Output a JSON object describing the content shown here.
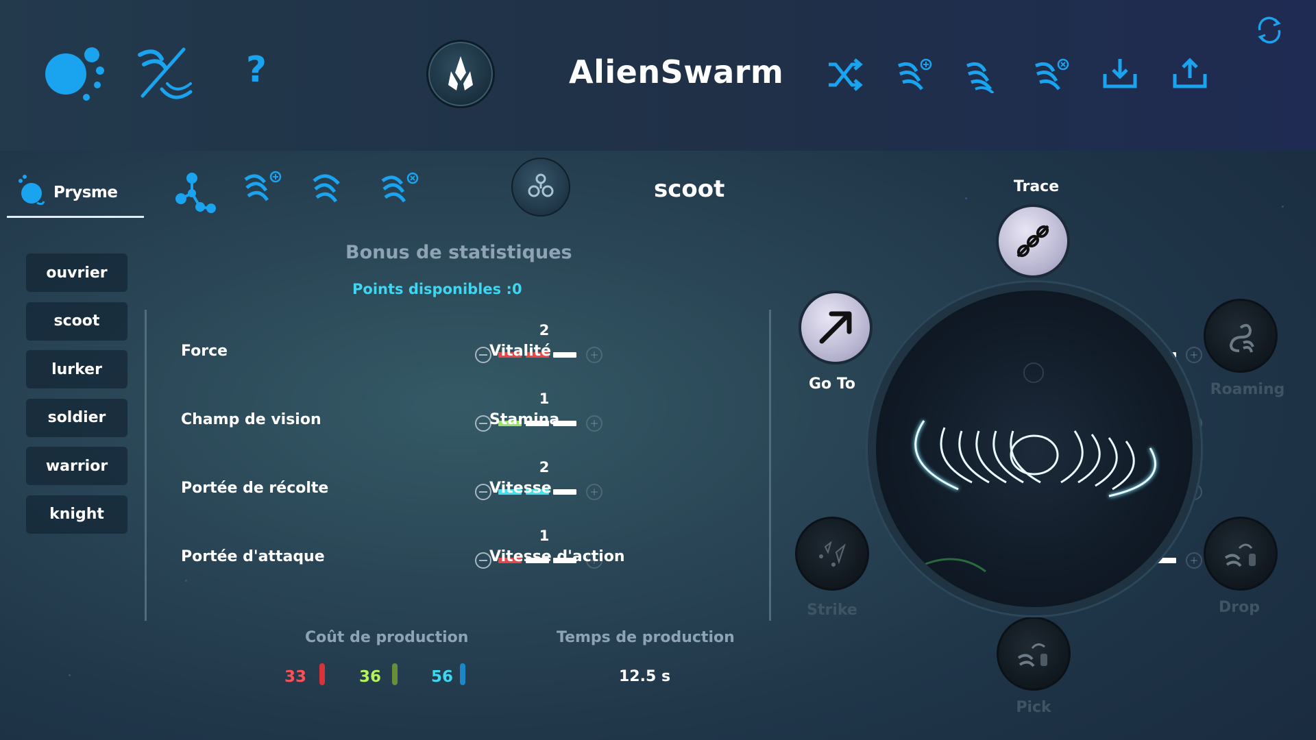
{
  "app": {
    "title": "AlienSwarm"
  },
  "topbar": {
    "left_icons": [
      "species-icon",
      "swarm-edit-icon",
      "help-icon"
    ],
    "right_icons": [
      "shuffle-icon",
      "add-swarm-icon",
      "swarm-icon",
      "remove-swarm-icon",
      "download-icon",
      "upload-icon"
    ],
    "corner_icon": "refresh-icon",
    "help_label": "?"
  },
  "species": {
    "tab_label": "Prysme"
  },
  "unit": {
    "title": "scoot"
  },
  "unit_list": [
    "ouvrier",
    "scoot",
    "lurker",
    "soldier",
    "warrior",
    "knight"
  ],
  "stats_panel": {
    "title": "Bonus de statistiques",
    "points_label": "Points disponibles :",
    "points_value": "0"
  },
  "stats": [
    {
      "name": "Force",
      "value": "2",
      "color": "#e8474a"
    },
    {
      "name": "Vitalité",
      "value": "1",
      "color": "#9be36b"
    },
    {
      "name": "Champ de vision",
      "value": "1",
      "color": "#9be36b"
    },
    {
      "name": "Stamina",
      "value": "1",
      "color": "#3fe2ee"
    },
    {
      "name": "Portée de récolte",
      "value": "2",
      "color": "#3fe2ee"
    },
    {
      "name": "Vitesse",
      "value": "1",
      "color": "#9be36b"
    },
    {
      "name": "Portée d'attaque",
      "value": "1",
      "color": "#e8474a"
    },
    {
      "name": "Vitesse d'action",
      "value": "1",
      "color": "#3fe2ee"
    }
  ],
  "production": {
    "cost_title": "Coût de production",
    "time_title": "Temps de production",
    "costs": [
      {
        "value": "33",
        "color": "#ff4f57"
      },
      {
        "value": "36",
        "color": "#b4f35c"
      },
      {
        "value": "56",
        "color": "#3fd6f0"
      }
    ],
    "time": "12.5 s"
  },
  "actions": {
    "trace": "Trace",
    "goto": "Go To",
    "roaming": "Roaming",
    "strike": "Strike",
    "drop": "Drop",
    "pick": "Pick"
  }
}
